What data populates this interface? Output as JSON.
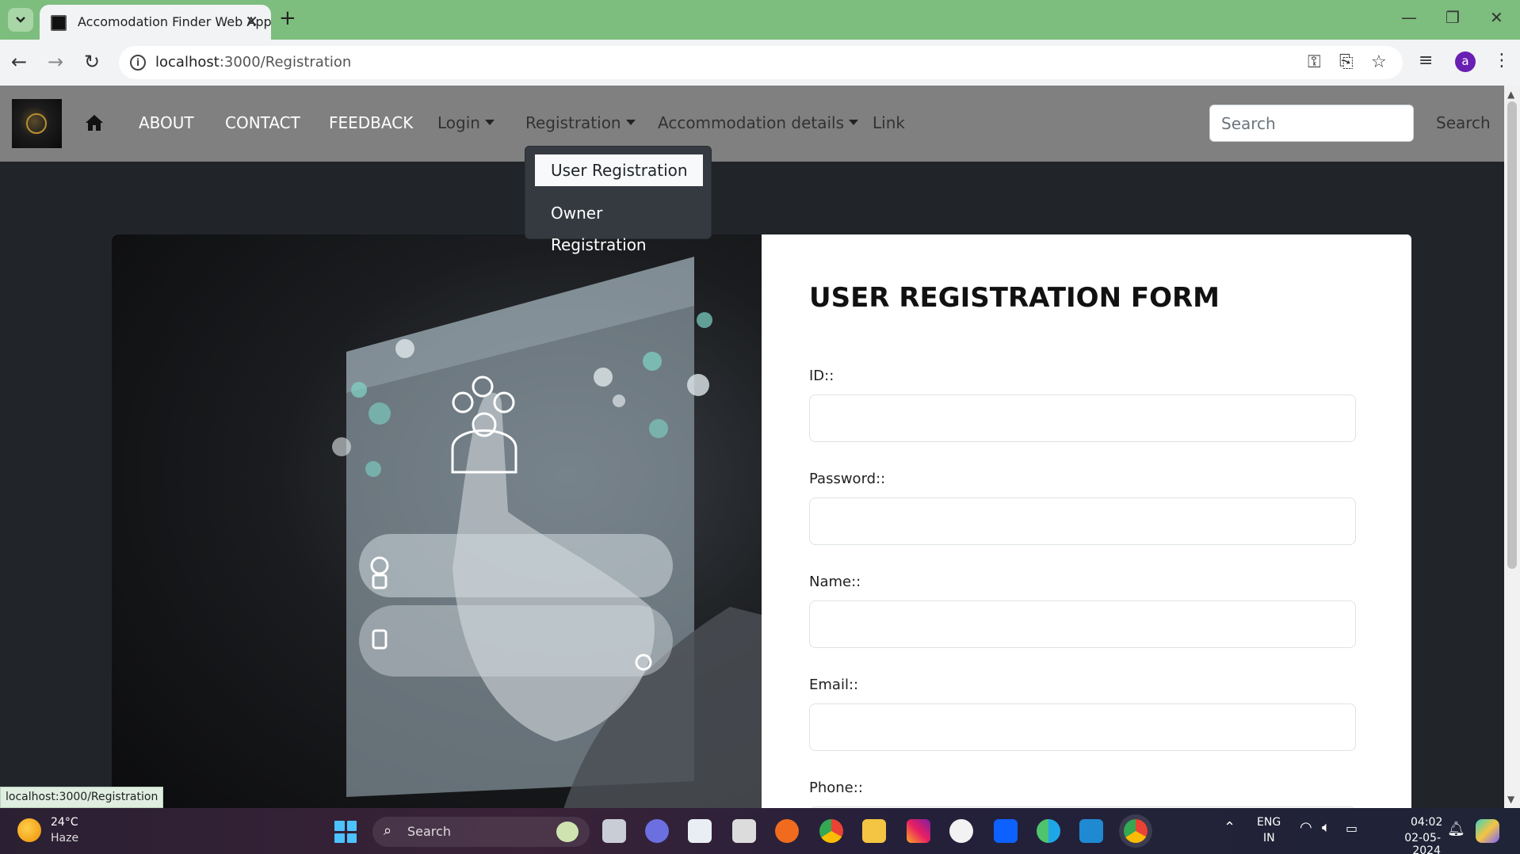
{
  "browser": {
    "tab_title": "Accomodation Finder Web App",
    "url_host": "localhost",
    "url_rest": ":3000/Registration",
    "status_url": "localhost:3000/Registration",
    "profile_initial": "a",
    "theme_color": "#7dbd7e"
  },
  "navbar": {
    "links": {
      "about": "ABOUT",
      "contact": "CONTACT",
      "feedback": "FEEDBACK",
      "login": "Login",
      "registration": "Registration",
      "accommodation": "Accommodation details",
      "link": "Link"
    },
    "search_placeholder": "Search",
    "search_button": "Search"
  },
  "dropdown": {
    "items": [
      "User Registration",
      "Owner Registration"
    ],
    "active_index": 0
  },
  "form": {
    "title": "USER REGISTRATION FORM",
    "fields": [
      "ID::",
      "Password::",
      "Name::",
      "Email::",
      "Phone::"
    ]
  },
  "taskbar": {
    "weather_temp": "24°C",
    "weather_desc": "Haze",
    "search_label": "Search",
    "lang_1": "ENG",
    "lang_2": "IN",
    "time": "04:02",
    "date": "02-05-2024"
  }
}
